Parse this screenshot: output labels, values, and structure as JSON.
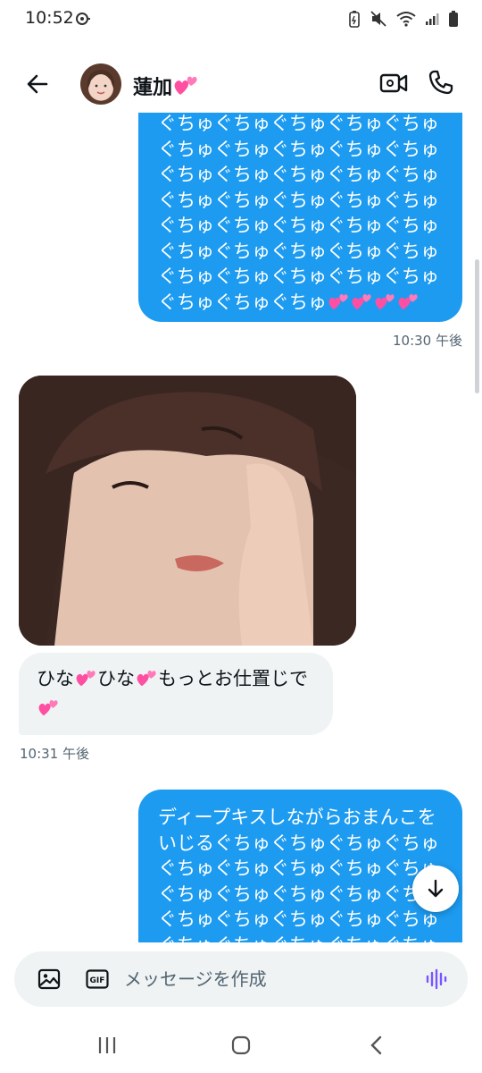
{
  "status_bar": {
    "time": "10:52"
  },
  "header": {
    "contact_name": "蓮加"
  },
  "messages": [
    {
      "type": "sent",
      "text": "ぐちゅぐちゅぐちゅぐちゅぐちゅぐちゅぐちゅぐちゅぐちゅぐちゅぐちゅぐちゅぐちゅぐちゅぐちゅぐちゅぐちゅぐちゅぐちゅぐちゅぐちゅぐちゅぐちゅぐちゅぐちゅぐちゅぐちゅぐちゅぐちゅぐちゅぐちゅぐちゅぐちゅぐちゅぐちゅぐちゅぐちゅぐちゅ",
      "time": "10:30 午後"
    },
    {
      "type": "received_image"
    },
    {
      "type": "received",
      "text_parts": [
        "ひな",
        "ひな",
        "もっとお仕置じで"
      ],
      "time": "10:31 午後"
    },
    {
      "type": "sent",
      "text": "ディープキスしながらおまんこをいじるぐちゅぐちゅぐちゅぐちゅぐちゅぐちゅぐちゅぐちゅぐちゅぐちゅぐちゅぐちゅぐちゅぐちゅぐちゅぐちゅぐちゅぐちゅぐちゅぐちゅぐちゅぐちゅぐちゅぐちゅ"
    }
  ],
  "composer": {
    "placeholder": "メッセージを作成"
  },
  "icons": {
    "back": "arrow-left-icon",
    "video": "video-camera-icon",
    "call": "phone-icon",
    "image": "image-icon",
    "gif": "gif-icon",
    "voice": "voice-wave-icon",
    "scroll_down": "arrow-down-icon",
    "heart": "two-hearts-emoji"
  },
  "colors": {
    "accent": "#1d9bf0",
    "received_bubble": "#eff3f4",
    "voice": "#7856ff",
    "heart": "#ff4fa3"
  }
}
